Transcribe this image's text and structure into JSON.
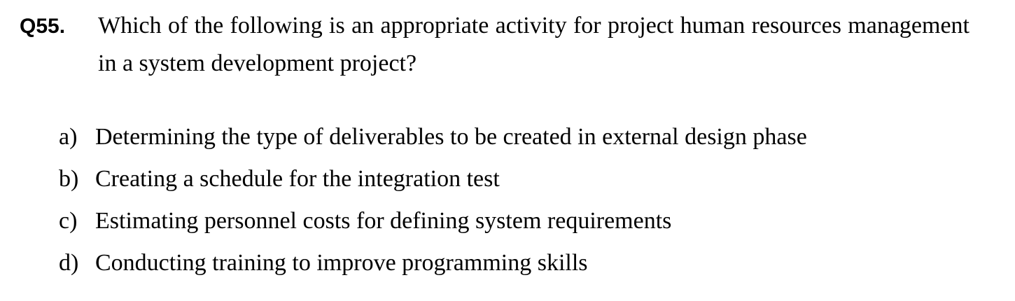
{
  "question": {
    "number": "Q55.",
    "text": "Which of the following is an appropriate activity for project human resources management in a system development project?"
  },
  "options": [
    {
      "letter": "a)",
      "text": "Determining the type of deliverables to be created in external design phase"
    },
    {
      "letter": "b)",
      "text": "Creating a schedule for the integration test"
    },
    {
      "letter": "c)",
      "text": "Estimating personnel costs for defining system requirements"
    },
    {
      "letter": "d)",
      "text": "Conducting training to improve programming skills"
    }
  ]
}
